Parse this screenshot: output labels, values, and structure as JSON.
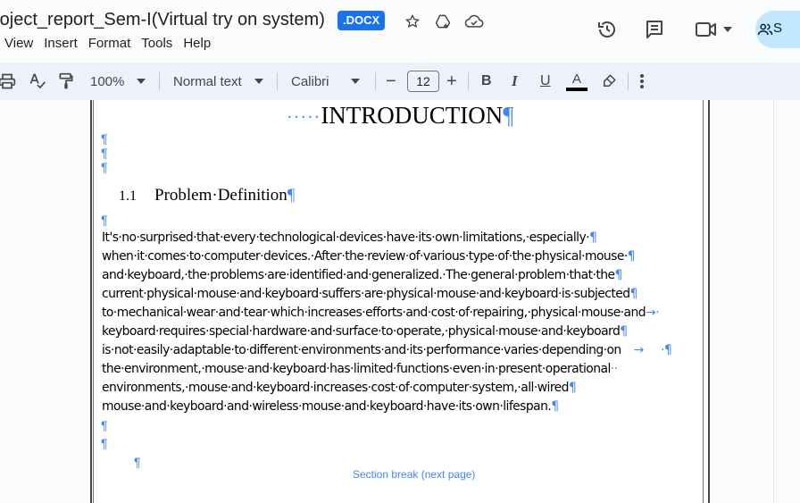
{
  "document": {
    "title": "roject_report_Sem-I(Virtual try on system)",
    "badge": ".DOCX"
  },
  "menu": [
    "View",
    "Insert",
    "Format",
    "Tools",
    "Help"
  ],
  "share": {
    "label": "S"
  },
  "toolbar": {
    "zoom": "100%",
    "style": "Normal text",
    "font": "Calibri",
    "font_size": "12",
    "minus": "−",
    "plus": "+",
    "bold": "B",
    "italic": "I",
    "underline": "U",
    "text_color": "A",
    "text_color_value": "#000000"
  },
  "body": {
    "title": "INTRODUCTION",
    "heading_number": "1.1",
    "heading_text": "Problem·Definition",
    "lines": [
      "It's·no·surprised·that·every·technological·devices·have·its·own·limitations,·especially·",
      "when·it·comes·to·computer·devices.·After·the·review·of·various·type·of·the·physical·mouse·",
      "and·keyboard,·the·problems·are·identified·and·generalized.·The·general·problem·that·the",
      "current·physical·mouse·and·keyboard·suffers·are·physical·mouse·and·keyboard·is·subjected",
      "to·mechanical·wear·and·tear·which·increases·efforts·and·cost·of·repairing,·physical·mouse·and",
      "keyboard·requires·special·hardware·and·surface·to·operate,·physical·mouse·and·keyboard",
      "is·not·easily·adaptable·to·different·environments·and·its·performance·varies·depending·on",
      "the·environment,·mouse·and·keyboard·has·limited·functions·even·in·present·operational",
      "environments,·mouse·and·keyboard·increases·cost·of·computer·system,·all·wired",
      "mouse·and·keyboard·and·wireless·mouse·and·keyboard·have·its·own·lifespan."
    ],
    "section_break": "Section break (next page)",
    "pilcrow": "¶"
  }
}
